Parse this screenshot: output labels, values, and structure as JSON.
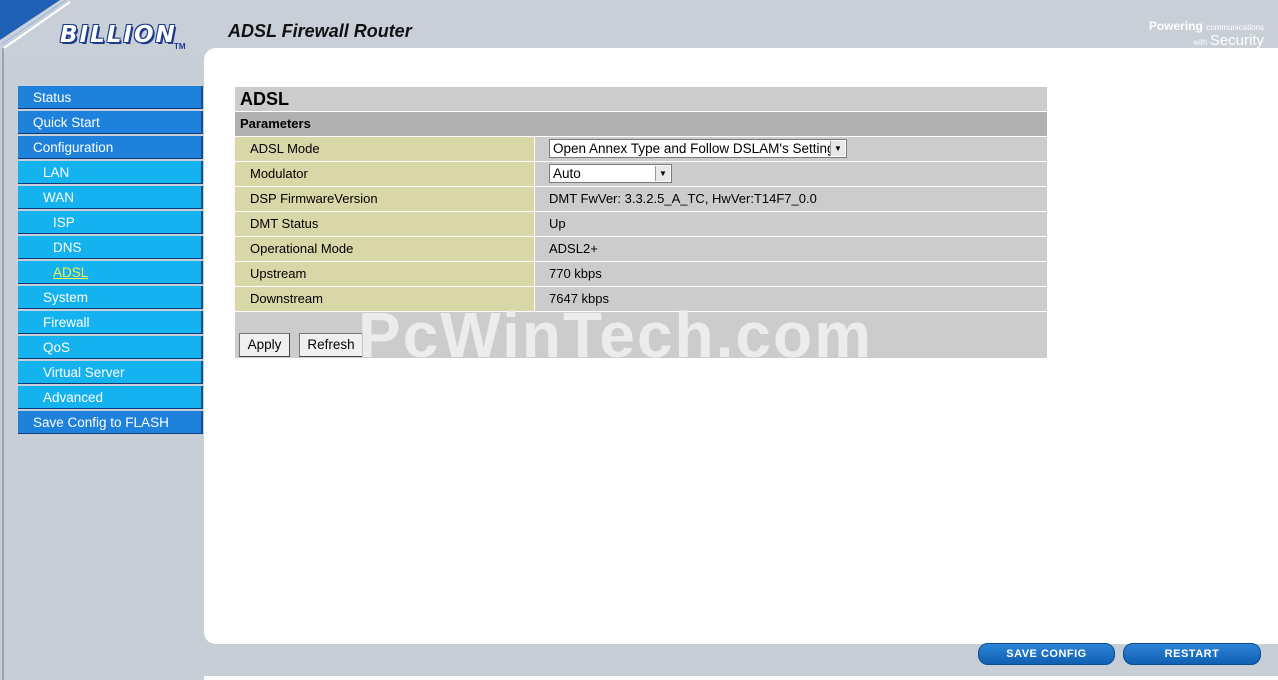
{
  "header": {
    "logo_text": "BILLION",
    "logo_tm": "TM",
    "product_title": "ADSL Firewall Router",
    "tagline_word1": "Powering",
    "tagline_small1": "communications",
    "tagline_small2": "with",
    "tagline_word2": "Security"
  },
  "sidebar": {
    "items": [
      {
        "label": "Status"
      },
      {
        "label": "Quick Start"
      },
      {
        "label": "Configuration"
      },
      {
        "label": "LAN"
      },
      {
        "label": "WAN"
      },
      {
        "label": "ISP"
      },
      {
        "label": "DNS"
      },
      {
        "label": "ADSL"
      },
      {
        "label": "System"
      },
      {
        "label": "Firewall"
      },
      {
        "label": "QoS"
      },
      {
        "label": "Virtual Server"
      },
      {
        "label": "Advanced"
      },
      {
        "label": "Save Config to FLASH"
      }
    ]
  },
  "main": {
    "section_title": "ADSL",
    "params_header": "Parameters",
    "rows": [
      {
        "label": "ADSL Mode",
        "value": "Open Annex Type and Follow DSLAM's Setting"
      },
      {
        "label": "Modulator",
        "value": "Auto"
      },
      {
        "label": "DSP FirmwareVersion",
        "value": "DMT FwVer: 3.3.2.5_A_TC, HwVer:T14F7_0.0"
      },
      {
        "label": "DMT Status",
        "value": "Up"
      },
      {
        "label": "Operational Mode",
        "value": "ADSL2+"
      },
      {
        "label": "Upstream",
        "value": "770 kbps"
      },
      {
        "label": "Downstream",
        "value": "7647 kbps"
      }
    ],
    "apply_label": "Apply",
    "refresh_label": "Refresh",
    "watermark": "PcWinTech.com"
  },
  "footer": {
    "save_config_label": "SAVE CONFIG",
    "restart_label": "RESTART"
  },
  "colors": {
    "nav_level1": "#1e82dc",
    "nav_level2": "#14b3f0",
    "nav_active_text": "#f6f14a",
    "label_cell": "#d9d6a8",
    "value_cell": "#cccccc"
  }
}
